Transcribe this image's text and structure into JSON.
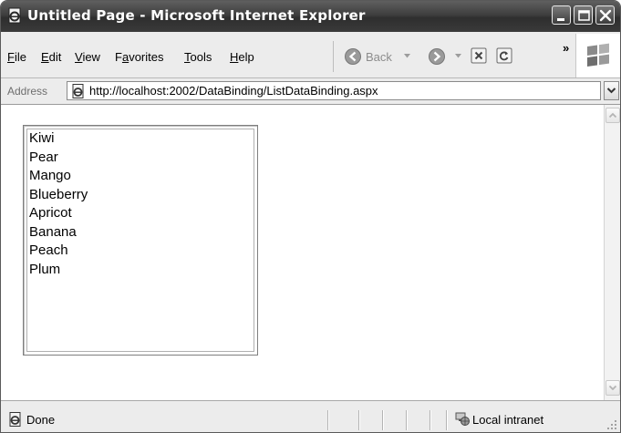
{
  "window": {
    "title": "Untitled Page - Microsoft Internet Explorer"
  },
  "menu": [
    {
      "label": "File",
      "accel": "F"
    },
    {
      "label": "Edit",
      "accel": "E"
    },
    {
      "label": "View",
      "accel": "V"
    },
    {
      "label": "Favorites",
      "accel": "a"
    },
    {
      "label": "Tools",
      "accel": "T"
    },
    {
      "label": "Help",
      "accel": "H"
    }
  ],
  "toolbar": {
    "back_label": "Back",
    "overflow_label": "»"
  },
  "address_bar": {
    "label": "Address",
    "url": "http://localhost:2002/DataBinding/ListDataBinding.aspx"
  },
  "listbox": {
    "items": [
      "Kiwi",
      "Pear",
      "Mango",
      "Blueberry",
      "Apricot",
      "Banana",
      "Peach",
      "Plum"
    ]
  },
  "status_bar": {
    "status_text": "Done",
    "zone_text": "Local intranet"
  },
  "icons": {
    "ie_page": "ie-page-icon",
    "back": "back-arrow-icon",
    "forward": "forward-arrow-icon",
    "stop": "stop-icon",
    "refresh": "refresh-icon",
    "windows_logo": "windows-logo-icon",
    "zone": "local-intranet-icon"
  },
  "colors": {
    "titlebar": "#3e3e3e",
    "chrome": "#ececec",
    "content": "#ffffff"
  }
}
